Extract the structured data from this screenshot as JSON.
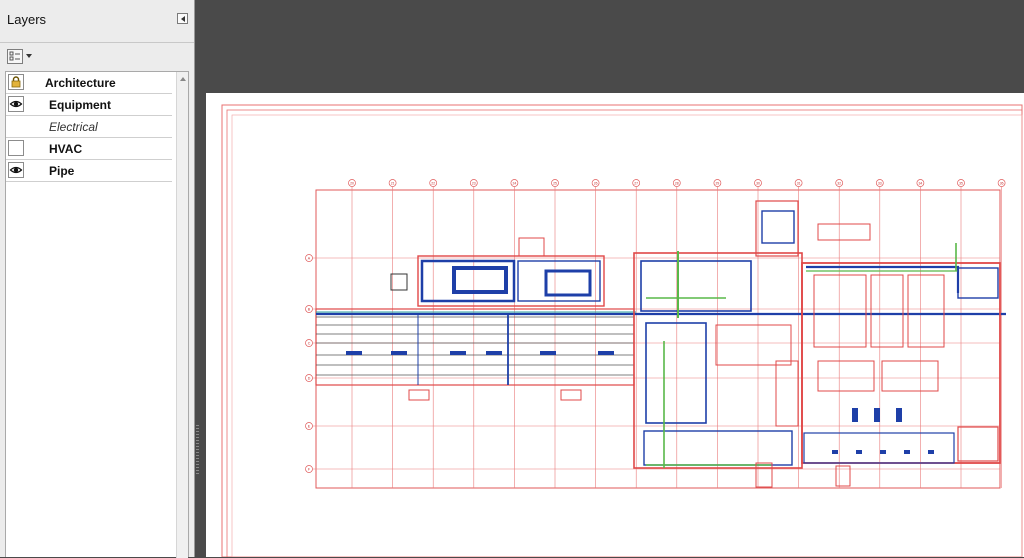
{
  "panel": {
    "title": "Layers",
    "icons": {
      "collapse": "collapse-left-icon",
      "options": "layer-options-icon",
      "lock": "lock-icon",
      "visible": "eye-icon",
      "grip": "resize-grip-icon"
    }
  },
  "layers": [
    {
      "name": "Architecture",
      "state": "locked",
      "style": "bold"
    },
    {
      "name": "Equipment",
      "state": "visible",
      "style": "bold"
    },
    {
      "name": "Electrical",
      "state": "none",
      "style": "italic"
    },
    {
      "name": "HVAC",
      "state": "hidden",
      "style": "bold"
    },
    {
      "name": "Pipe",
      "state": "visible",
      "style": "bold"
    }
  ],
  "colors": {
    "architecture": "#e03c3c",
    "equipment": "#1e3fa8",
    "pipe": "#58b848",
    "workspace": "#4a4a4a",
    "panel": "#ececec"
  },
  "drawing": {
    "grid_labels": [
      "20",
      "21",
      "22",
      "23",
      "24",
      "25",
      "26",
      "27",
      "28",
      "29",
      "30",
      "31",
      "32",
      "33",
      "34",
      "35",
      "36"
    ],
    "row_labels": [
      "A",
      "B",
      "C",
      "D",
      "E",
      "F"
    ]
  }
}
